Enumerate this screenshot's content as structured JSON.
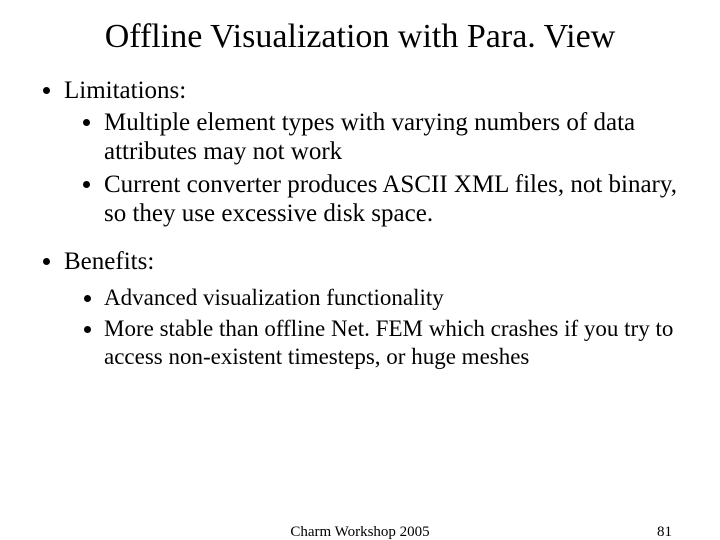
{
  "title": "Offline Visualization with Para. View",
  "bullets": {
    "limitations_label": "Limitations:",
    "limitations": [
      "Multiple element types with varying numbers of data attributes may not work",
      "Current converter produces ASCII XML files, not binary, so they use excessive disk space."
    ],
    "benefits_label": "Benefits:",
    "benefits": [
      "Advanced visualization functionality",
      "More stable than offline Net. FEM which crashes if you try to access non-existent timesteps, or huge meshes"
    ]
  },
  "footer": {
    "center": "Charm Workshop 2005",
    "page_number": "81"
  }
}
